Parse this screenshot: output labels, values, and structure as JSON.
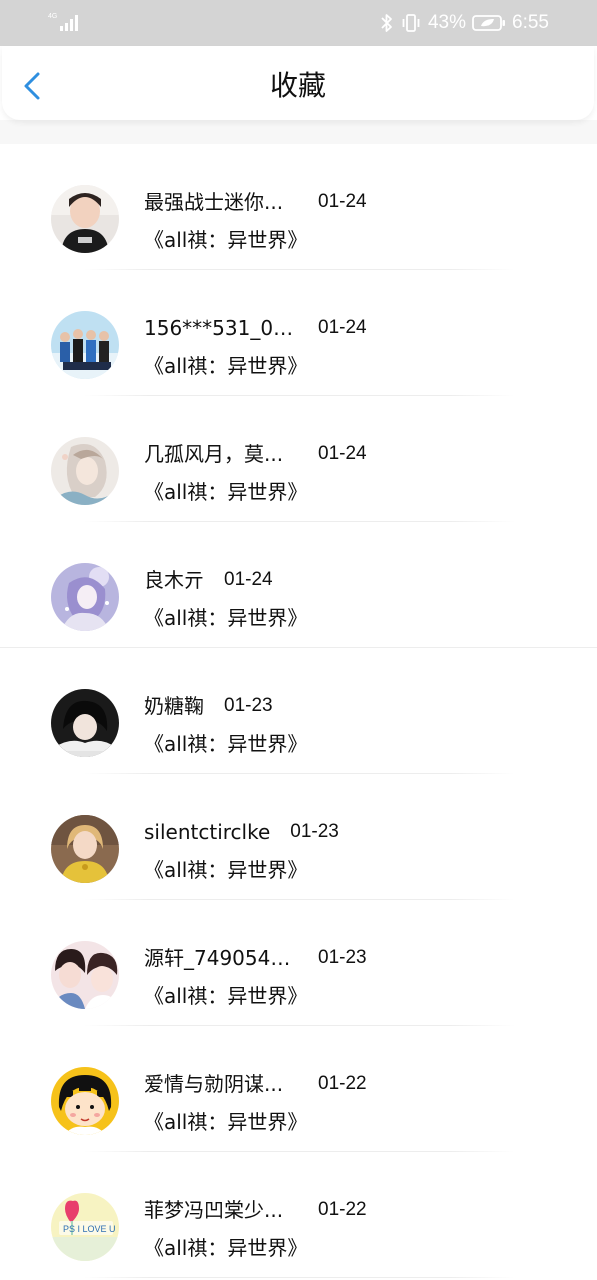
{
  "status_bar": {
    "network_label": "4G",
    "battery_percent": "43%",
    "time": "6:55",
    "icons": [
      "signal-icon",
      "bluetooth-icon",
      "vibrate-icon",
      "battery-icon"
    ]
  },
  "header": {
    "title": "收藏",
    "back_icon": "chevron-left-icon",
    "accent_color": "#2f8fe0"
  },
  "favorites": [
    {
      "name": "最强战士迷你...",
      "date": "01-24",
      "book": "《all祺：异世界》",
      "avatar": "photo-child"
    },
    {
      "name": "156***531_08...",
      "date": "01-24",
      "book": "《all祺：异世界》",
      "avatar": "photo-group"
    },
    {
      "name": "几孤风月，莫...",
      "date": "01-24",
      "book": "《all祺：异世界》",
      "avatar": "illustration-girl"
    },
    {
      "name": "良木亓",
      "date": "01-24",
      "book": "《all祺：异世界》",
      "avatar": "illustration-purple"
    },
    {
      "name": "奶糖鞠",
      "date": "01-23",
      "book": "《all祺：异世界》",
      "avatar": "photo-dark-portrait"
    },
    {
      "name": "silentctirclke",
      "date": "01-23",
      "book": "《all祺：异世界》",
      "avatar": "photo-girl-yellow"
    },
    {
      "name": "源轩_7490544...",
      "date": "01-23",
      "book": "《all祺：异世界》",
      "avatar": "photo-two-people"
    },
    {
      "name": "爱情与勍阴谋...",
      "date": "01-22",
      "book": "《all祺：异世界》",
      "avatar": "cartoon-girl"
    },
    {
      "name": "菲梦冯凹棠少...",
      "date": "01-22",
      "book": "《all祺：异世界》",
      "avatar": "note-heart"
    }
  ],
  "avatar_note_text": "PS I LOVE U"
}
